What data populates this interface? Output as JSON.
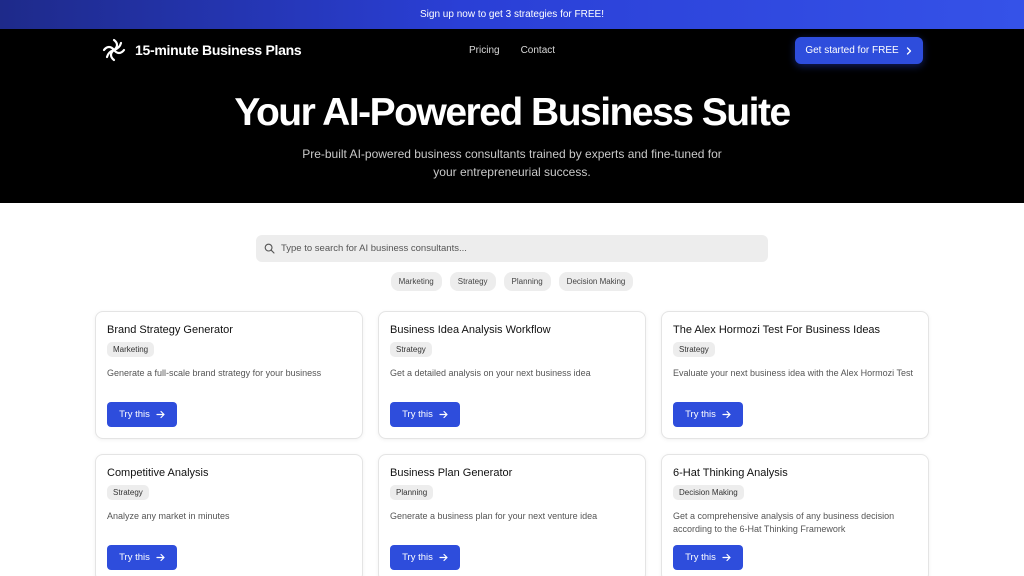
{
  "promo": {
    "text": "Sign up now to get 3 strategies for FREE!"
  },
  "brand": {
    "name": "15-minute Business Plans",
    "logo_icon": "spiral-logo-icon"
  },
  "nav": {
    "items": [
      {
        "label": "Pricing"
      },
      {
        "label": "Contact"
      }
    ]
  },
  "header_cta": {
    "label": "Get started for FREE",
    "icon": "chevron-right-icon"
  },
  "hero": {
    "title": "Your AI-Powered Business Suite",
    "subtitle": "Pre-built AI-powered business consultants trained by experts and fine-tuned for your entrepreneurial success."
  },
  "search": {
    "placeholder": "Type to search for AI business consultants...",
    "value": "",
    "icon": "search-icon"
  },
  "filters": [
    {
      "label": "Marketing"
    },
    {
      "label": "Strategy"
    },
    {
      "label": "Planning"
    },
    {
      "label": "Decision Making"
    }
  ],
  "cards": [
    {
      "title": "Brand Strategy Generator",
      "tag": "Marketing",
      "description": "Generate a full-scale brand strategy for your business",
      "button": "Try this"
    },
    {
      "title": "Business Idea Analysis Workflow",
      "tag": "Strategy",
      "description": "Get a detailed analysis on your next business idea",
      "button": "Try this"
    },
    {
      "title": "The Alex Hormozi Test For Business Ideas",
      "tag": "Strategy",
      "description": "Evaluate your next business idea with the Alex Hormozi Test",
      "button": "Try this"
    },
    {
      "title": "Competitive Analysis",
      "tag": "Strategy",
      "description": "Analyze any market in minutes",
      "button": "Try this"
    },
    {
      "title": "Business Plan Generator",
      "tag": "Planning",
      "description": "Generate a business plan for your next venture idea",
      "button": "Try this"
    },
    {
      "title": "6-Hat Thinking Analysis",
      "tag": "Decision Making",
      "description": "Get a comprehensive analysis of any business decision according to the 6-Hat Thinking Framework",
      "button": "Try this"
    }
  ],
  "colors": {
    "accent": "#2e4ddc",
    "hero_bg": "#000000",
    "promo_gradient_start": "#1e2a8a",
    "promo_gradient_end": "#3552e8"
  }
}
